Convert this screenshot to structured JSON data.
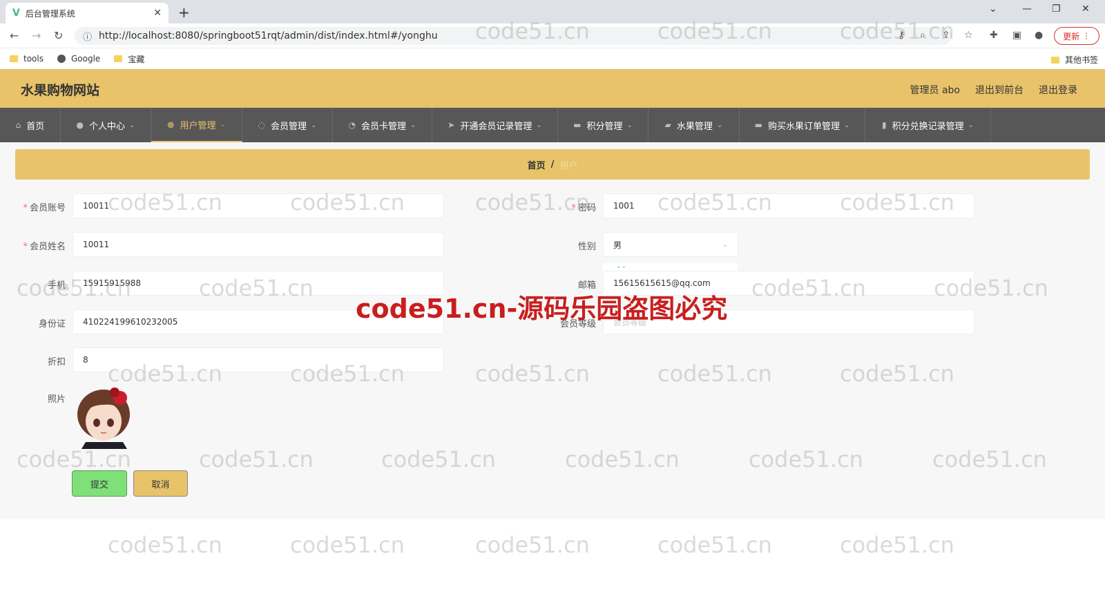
{
  "browser": {
    "tab_title": "后台管理系统",
    "url": "http://localhost:8080/springboot51rqt/admin/dist/index.html#/yonghu",
    "update_label": "更新",
    "bookmarks": [
      "tools",
      "Google",
      "宝藏"
    ],
    "other_bookmarks": "其他书签"
  },
  "header": {
    "site_name": "水果购物网站",
    "admin_label": "管理员 abo",
    "to_front": "退出到前台",
    "logout": "退出登录"
  },
  "menu": [
    {
      "label": "首页",
      "icon": "home-icon",
      "active": false
    },
    {
      "label": "个人中心",
      "icon": "user-icon",
      "active": false
    },
    {
      "label": "用户管理",
      "icon": "users-icon",
      "active": true
    },
    {
      "label": "会员管理",
      "icon": "member-icon",
      "active": false
    },
    {
      "label": "会员卡管理",
      "icon": "card-icon",
      "active": false
    },
    {
      "label": "开通会员记录管理",
      "icon": "record-icon",
      "active": false
    },
    {
      "label": "积分管理",
      "icon": "points-icon",
      "active": false
    },
    {
      "label": "水果管理",
      "icon": "fruit-icon",
      "active": false
    },
    {
      "label": "购买水果订单管理",
      "icon": "order-icon",
      "active": false
    },
    {
      "label": "积分兑换记录管理",
      "icon": "exchange-icon",
      "active": false
    }
  ],
  "breadcrumb": {
    "home": "首页",
    "separator": "/",
    "current": "用户"
  },
  "form": {
    "account_label": "会员账号",
    "account_value": "10011",
    "password_label": "密码",
    "password_value": "1001",
    "name_label": "会员姓名",
    "name_value": "10011",
    "gender_label": "性别",
    "gender_value": "男",
    "phone_label": "手机",
    "phone_value": "15915915988",
    "email_label": "邮箱",
    "email_value": "15615615615@qq.com",
    "idcard_label": "身份证",
    "idcard_value": "410224199610232005",
    "level_label": "会员等级",
    "level_placeholder": "会员等级",
    "discount_label": "折扣",
    "discount_value": "8",
    "photo_label": "照片"
  },
  "buttons": {
    "submit": "提交",
    "cancel": "取消"
  },
  "watermark": {
    "text": "code51.cn",
    "red_text": "code51.cn-源码乐园盗图必究"
  }
}
